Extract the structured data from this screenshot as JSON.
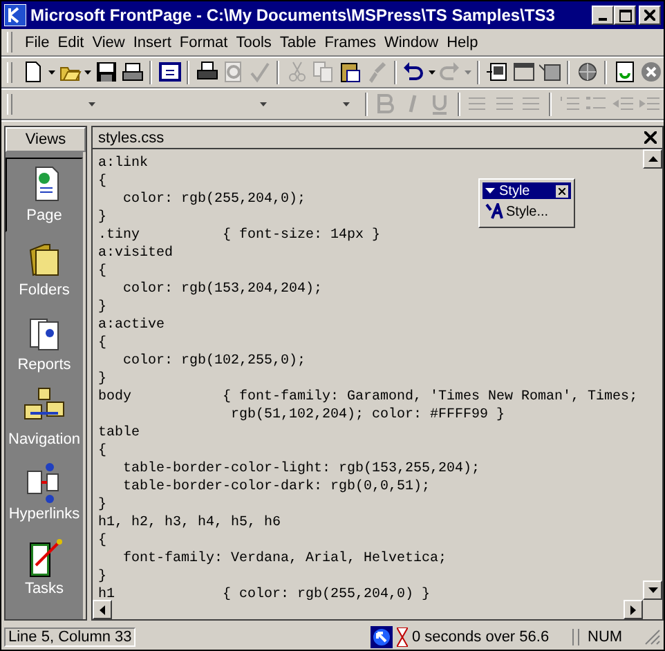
{
  "window": {
    "title": "Microsoft FrontPage - C:\\My Documents\\MSPress\\TS Samples\\TS3"
  },
  "menu": [
    "File",
    "Edit",
    "View",
    "Insert",
    "Format",
    "Tools",
    "Table",
    "Frames",
    "Window",
    "Help"
  ],
  "toolbar": [
    {
      "disabled": false
    },
    {
      "disabled": false
    },
    {
      "disabled": false
    },
    {
      "disabled": false
    },
    {
      "disabled": false
    },
    {
      "disabled": false
    },
    {
      "disabled": true
    },
    {
      "disabled": true
    },
    {
      "disabled": true
    },
    {
      "disabled": true
    },
    {
      "disabled": false
    },
    {
      "disabled": true
    },
    {
      "disabled": false
    },
    {
      "disabled": true
    },
    {
      "disabled": false
    },
    {
      "disabled": false
    },
    {
      "disabled": false
    },
    {
      "disabled": false
    },
    {
      "disabled": false
    },
    {
      "disabled": false
    }
  ],
  "format_toolbar": {
    "disabled": true
  },
  "views": {
    "title": "Views",
    "items": [
      {
        "label": "Page",
        "selected": true
      },
      {
        "label": "Folders",
        "selected": false
      },
      {
        "label": "Reports",
        "selected": false
      },
      {
        "label": "Navigation",
        "selected": false
      },
      {
        "label": "Hyperlinks",
        "selected": false
      },
      {
        "label": "Tasks",
        "selected": false
      }
    ]
  },
  "editor": {
    "tab": "styles.css",
    "lines": [
      "a:link",
      "{",
      "   color: rgb(255,204,0);",
      "}",
      ".tiny          { font-size: 14px }",
      "a:visited",
      "{",
      "   color: rgb(153,204,204);",
      "}",
      "a:active",
      "{",
      "   color: rgb(102,255,0);",
      "}",
      "body           { font-family: Garamond, 'Times New Roman', Times;",
      "                rgb(51,102,204); color: #FFFF99 }",
      "table",
      "{",
      "   table-border-color-light: rgb(153,255,204);",
      "   table-border-color-dark: rgb(0,0,51);",
      "}",
      "h1, h2, h3, h4, h5, h6",
      "{",
      "   font-family: Verdana, Arial, Helvetica;",
      "}",
      "h1             { color: rgb(255,204,0) }"
    ]
  },
  "style_toolbar": {
    "title": "Style",
    "button": "Style..."
  },
  "status_bar": {
    "position": "Line 5, Column 33",
    "download": "0 seconds over 56.6",
    "num": "NUM"
  }
}
